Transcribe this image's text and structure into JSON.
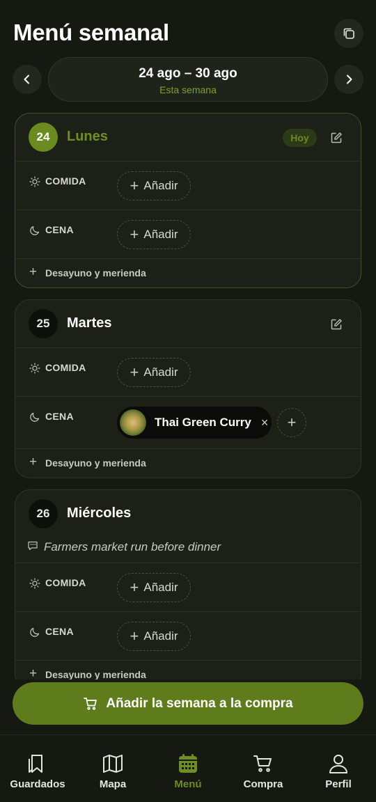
{
  "header": {
    "title": "Menú semanal",
    "copy_icon": "copy-icon"
  },
  "week": {
    "range": "24 ago – 30 ago",
    "subtitle": "Esta semana",
    "prev_icon": "chevron-left-icon",
    "next_icon": "chevron-right-icon"
  },
  "days": [
    {
      "number": "24",
      "name": "Lunes",
      "badge": "Hoy",
      "is_today": true,
      "meals": [
        {
          "label": "COMIDA",
          "icon": "sun-icon",
          "add_label": "Añadir"
        },
        {
          "label": "CENA",
          "icon": "moon-icon",
          "add_label": "Añadir"
        }
      ],
      "extra_label": "Desayuno y merienda"
    },
    {
      "number": "25",
      "name": "Martes",
      "is_today": false,
      "meals": [
        {
          "label": "COMIDA",
          "icon": "sun-icon",
          "add_label": "Añadir"
        },
        {
          "label": "CENA",
          "icon": "moon-icon",
          "recipe": "Thai Green Curry",
          "remove_symbol": "×",
          "add_symbol": "+"
        }
      ],
      "extra_label": "Desayuno y merienda"
    },
    {
      "number": "26",
      "name": "Miércoles",
      "is_today": false,
      "note": "Farmers market run before dinner",
      "meals": [
        {
          "label": "COMIDA",
          "icon": "sun-icon",
          "add_label": "Añadir"
        },
        {
          "label": "CENA",
          "icon": "moon-icon",
          "add_label": "Añadir"
        }
      ],
      "extra_label": "Desayuno y merienda"
    }
  ],
  "cta": {
    "label": "Añadir la semana a la compra",
    "icon": "cart-icon"
  },
  "nav": [
    {
      "label": "Guardados",
      "icon": "bookmark-icon",
      "active": false
    },
    {
      "label": "Mapa",
      "icon": "map-icon",
      "active": false
    },
    {
      "label": "Menú",
      "icon": "calendar-icon",
      "active": true
    },
    {
      "label": "Compra",
      "icon": "cart-icon",
      "active": false
    },
    {
      "label": "Perfil",
      "icon": "user-icon",
      "active": false
    }
  ],
  "colors": {
    "background": "#161912",
    "accent": "#6b8a1f",
    "card": "#1c2017",
    "cta": "#5f7c1d"
  }
}
